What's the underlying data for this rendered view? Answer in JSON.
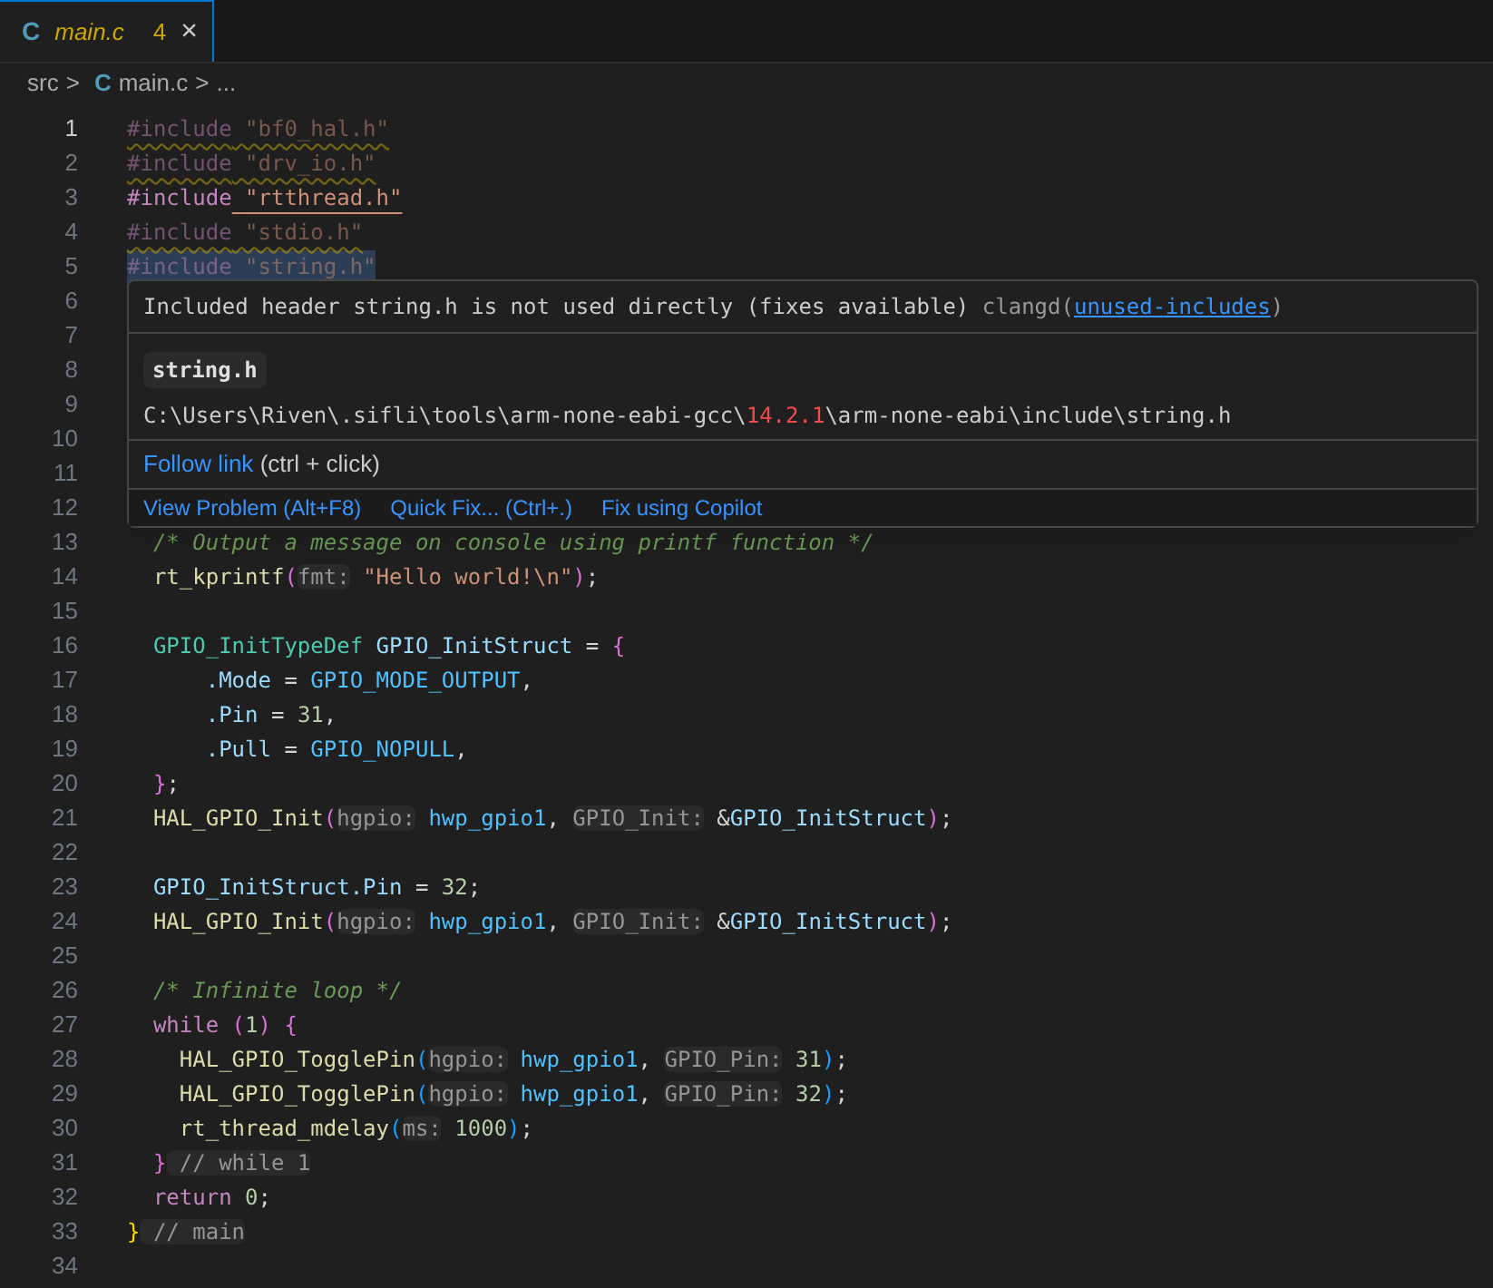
{
  "tab": {
    "file_icon": "C",
    "label": "main.c",
    "problems": "4",
    "close": "×",
    "selected": true
  },
  "breadcrumb": {
    "folder": "src",
    "separator": ">",
    "file_icon": "C",
    "file": "main.c",
    "separator_2": ">",
    "more": "..."
  },
  "lines": [
    {
      "number": "1",
      "active": true,
      "dimmed": true,
      "squiggle": true,
      "highlighted": false,
      "tokens": [
        {
          "kind": "keyword",
          "text": "#include"
        },
        {
          "kind": "string",
          "text": " \"bf0_hal.h\""
        }
      ]
    },
    {
      "number": "2",
      "active": false,
      "dimmed": true,
      "squiggle": true,
      "highlighted": false,
      "tokens": [
        {
          "kind": "keyword",
          "text": "#include"
        },
        {
          "kind": "string",
          "text": " \"drv_io.h\""
        }
      ]
    },
    {
      "number": "3",
      "active": false,
      "dimmed": false,
      "squiggle": false,
      "highlighted": false,
      "tokens": [
        {
          "kind": "keyword",
          "text": "#include"
        },
        {
          "kind": "link_string",
          "text": "\"rtthread.h\""
        }
      ]
    },
    {
      "number": "4",
      "active": false,
      "dimmed": true,
      "squiggle": true,
      "highlighted": false,
      "tokens": [
        {
          "kind": "keyword",
          "text": "#include"
        },
        {
          "kind": "string",
          "text": " \"stdio.h\""
        }
      ]
    },
    {
      "number": "5",
      "active": false,
      "dimmed": true,
      "squiggle": true,
      "highlighted": true,
      "tokens": [
        {
          "kind": "keyword",
          "text": "#include"
        },
        {
          "kind": "string",
          "text": " \"string.h\""
        }
      ]
    },
    {
      "number": "6",
      "active": false
    },
    {
      "number": "7",
      "active": false
    },
    {
      "number": "8",
      "active": false
    },
    {
      "number": "9",
      "active": false
    },
    {
      "number": "10",
      "active": false
    },
    {
      "number": "11",
      "active": false
    },
    {
      "number": "12",
      "active": false
    },
    {
      "number": "13",
      "active": false,
      "tokens": [
        {
          "kind": "comment",
          "text": "  /* Output a message on console using printf function */"
        }
      ]
    },
    {
      "number": "14",
      "active": false,
      "tokens": [
        {
          "kind": "func",
          "text": "  rt_kprintf"
        },
        {
          "kind": "bracket2",
          "text": "("
        },
        {
          "kind": "hint",
          "text": "fmt:"
        },
        {
          "kind": "string",
          "text": " \"Hello world!\\n\""
        },
        {
          "kind": "bracket2",
          "text": ")"
        },
        {
          "kind": "plain",
          "text": ";"
        }
      ]
    },
    {
      "number": "15",
      "active": false
    },
    {
      "number": "16",
      "active": false,
      "tokens": [
        {
          "kind": "type",
          "text": "  GPIO_InitTypeDef"
        },
        {
          "kind": "var",
          "text": " GPIO_InitStruct"
        },
        {
          "kind": "plain",
          "text": " = "
        },
        {
          "kind": "bracket2",
          "text": "{"
        }
      ]
    },
    {
      "number": "17",
      "active": false,
      "tokens": [
        {
          "kind": "var",
          "text": "      .Mode"
        },
        {
          "kind": "plain",
          "text": " = "
        },
        {
          "kind": "const",
          "text": "GPIO_MODE_OUTPUT"
        },
        {
          "kind": "plain",
          "text": ","
        }
      ]
    },
    {
      "number": "18",
      "active": false,
      "tokens": [
        {
          "kind": "var",
          "text": "      .Pin"
        },
        {
          "kind": "plain",
          "text": " = "
        },
        {
          "kind": "number",
          "text": "31"
        },
        {
          "kind": "plain",
          "text": ","
        }
      ]
    },
    {
      "number": "19",
      "active": false,
      "tokens": [
        {
          "kind": "var",
          "text": "      .Pull"
        },
        {
          "kind": "plain",
          "text": " = "
        },
        {
          "kind": "const",
          "text": "GPIO_NOPULL"
        },
        {
          "kind": "plain",
          "text": ","
        }
      ]
    },
    {
      "number": "20",
      "active": false,
      "tokens": [
        {
          "kind": "bracket2",
          "text": "  }"
        },
        {
          "kind": "plain",
          "text": ";"
        }
      ]
    },
    {
      "number": "21",
      "active": false,
      "tokens": [
        {
          "kind": "func",
          "text": "  HAL_GPIO_Init"
        },
        {
          "kind": "bracket2",
          "text": "("
        },
        {
          "kind": "hint",
          "text": "hgpio:"
        },
        {
          "kind": "const",
          "text": " hwp_gpio1"
        },
        {
          "kind": "plain",
          "text": ", "
        },
        {
          "kind": "hint",
          "text": "GPIO_Init:"
        },
        {
          "kind": "plain",
          "text": " &"
        },
        {
          "kind": "var",
          "text": "GPIO_InitStruct"
        },
        {
          "kind": "bracket2",
          "text": ")"
        },
        {
          "kind": "plain",
          "text": ";"
        }
      ]
    },
    {
      "number": "22",
      "active": false
    },
    {
      "number": "23",
      "active": false,
      "tokens": [
        {
          "kind": "var",
          "text": "  GPIO_InitStruct.Pin"
        },
        {
          "kind": "plain",
          "text": " = "
        },
        {
          "kind": "number",
          "text": "32"
        },
        {
          "kind": "plain",
          "text": ";"
        }
      ]
    },
    {
      "number": "24",
      "active": false,
      "tokens": [
        {
          "kind": "func",
          "text": "  HAL_GPIO_Init"
        },
        {
          "kind": "bracket2",
          "text": "("
        },
        {
          "kind": "hint",
          "text": "hgpio:"
        },
        {
          "kind": "const",
          "text": " hwp_gpio1"
        },
        {
          "kind": "plain",
          "text": ", "
        },
        {
          "kind": "hint",
          "text": "GPIO_Init:"
        },
        {
          "kind": "plain",
          "text": " &"
        },
        {
          "kind": "var",
          "text": "GPIO_InitStruct"
        },
        {
          "kind": "bracket2",
          "text": ")"
        },
        {
          "kind": "plain",
          "text": ";"
        }
      ]
    },
    {
      "number": "25",
      "active": false
    },
    {
      "number": "26",
      "active": false,
      "tokens": [
        {
          "kind": "comment",
          "text": "  /* Infinite loop */"
        }
      ]
    },
    {
      "number": "27",
      "active": false,
      "tokens": [
        {
          "kind": "keyword",
          "text": "  while"
        },
        {
          "kind": "bracket2",
          "text": " ("
        },
        {
          "kind": "number",
          "text": "1"
        },
        {
          "kind": "bracket2",
          "text": ")"
        },
        {
          "kind": "bracket2",
          "text": " {"
        }
      ]
    },
    {
      "number": "28",
      "active": false,
      "tokens": [
        {
          "kind": "func",
          "text": "    HAL_GPIO_TogglePin"
        },
        {
          "kind": "bracket3",
          "text": "("
        },
        {
          "kind": "hint",
          "text": "hgpio:"
        },
        {
          "kind": "const",
          "text": " hwp_gpio1"
        },
        {
          "kind": "plain",
          "text": ", "
        },
        {
          "kind": "hint",
          "text": "GPIO_Pin:"
        },
        {
          "kind": "number",
          "text": " 31"
        },
        {
          "kind": "bracket3",
          "text": ")"
        },
        {
          "kind": "plain",
          "text": ";"
        }
      ]
    },
    {
      "number": "29",
      "active": false,
      "tokens": [
        {
          "kind": "func",
          "text": "    HAL_GPIO_TogglePin"
        },
        {
          "kind": "bracket3",
          "text": "("
        },
        {
          "kind": "hint",
          "text": "hgpio:"
        },
        {
          "kind": "const",
          "text": " hwp_gpio1"
        },
        {
          "kind": "plain",
          "text": ", "
        },
        {
          "kind": "hint",
          "text": "GPIO_Pin:"
        },
        {
          "kind": "number",
          "text": " 32"
        },
        {
          "kind": "bracket3",
          "text": ")"
        },
        {
          "kind": "plain",
          "text": ";"
        }
      ]
    },
    {
      "number": "30",
      "active": false,
      "tokens": [
        {
          "kind": "func",
          "text": "    rt_thread_mdelay"
        },
        {
          "kind": "bracket3",
          "text": "("
        },
        {
          "kind": "hint",
          "text": "ms:"
        },
        {
          "kind": "number",
          "text": " 1000"
        },
        {
          "kind": "bracket3",
          "text": ")"
        },
        {
          "kind": "plain",
          "text": ";"
        }
      ]
    },
    {
      "number": "31",
      "active": false,
      "tokens": [
        {
          "kind": "bracket2",
          "text": "  }"
        },
        {
          "kind": "hint",
          "text": " // while 1"
        }
      ]
    },
    {
      "number": "32",
      "active": false,
      "tokens": [
        {
          "kind": "keyword",
          "text": "  return"
        },
        {
          "kind": "number",
          "text": " 0"
        },
        {
          "kind": "plain",
          "text": ";"
        }
      ]
    },
    {
      "number": "33",
      "active": false,
      "tokens": [
        {
          "kind": "bracket1",
          "text": "}"
        },
        {
          "kind": "hint",
          "text": " // main"
        }
      ]
    },
    {
      "number": "34",
      "active": false
    }
  ],
  "hover": {
    "message": "Included header string.h is not used directly (fixes available)",
    "source": "clangd(",
    "code_link": "unused-includes",
    "source_end": ")",
    "header": "string.h",
    "path": [
      {
        "kind": "plain",
        "text": "C:\\Users\\Riven\\.sifli\\tools\\arm-none-eabi-gcc\\"
      },
      {
        "kind": "error",
        "text": "14.2.1"
      },
      {
        "kind": "plain",
        "text": "\\arm-none-eabi\\include\\string.h"
      }
    ],
    "follow_link": "Follow link",
    "follow_hint": "(ctrl + click)",
    "actions": [
      "View Problem (Alt+F8)",
      "Quick Fix... (Ctrl+.)",
      "Fix using Copilot"
    ]
  }
}
